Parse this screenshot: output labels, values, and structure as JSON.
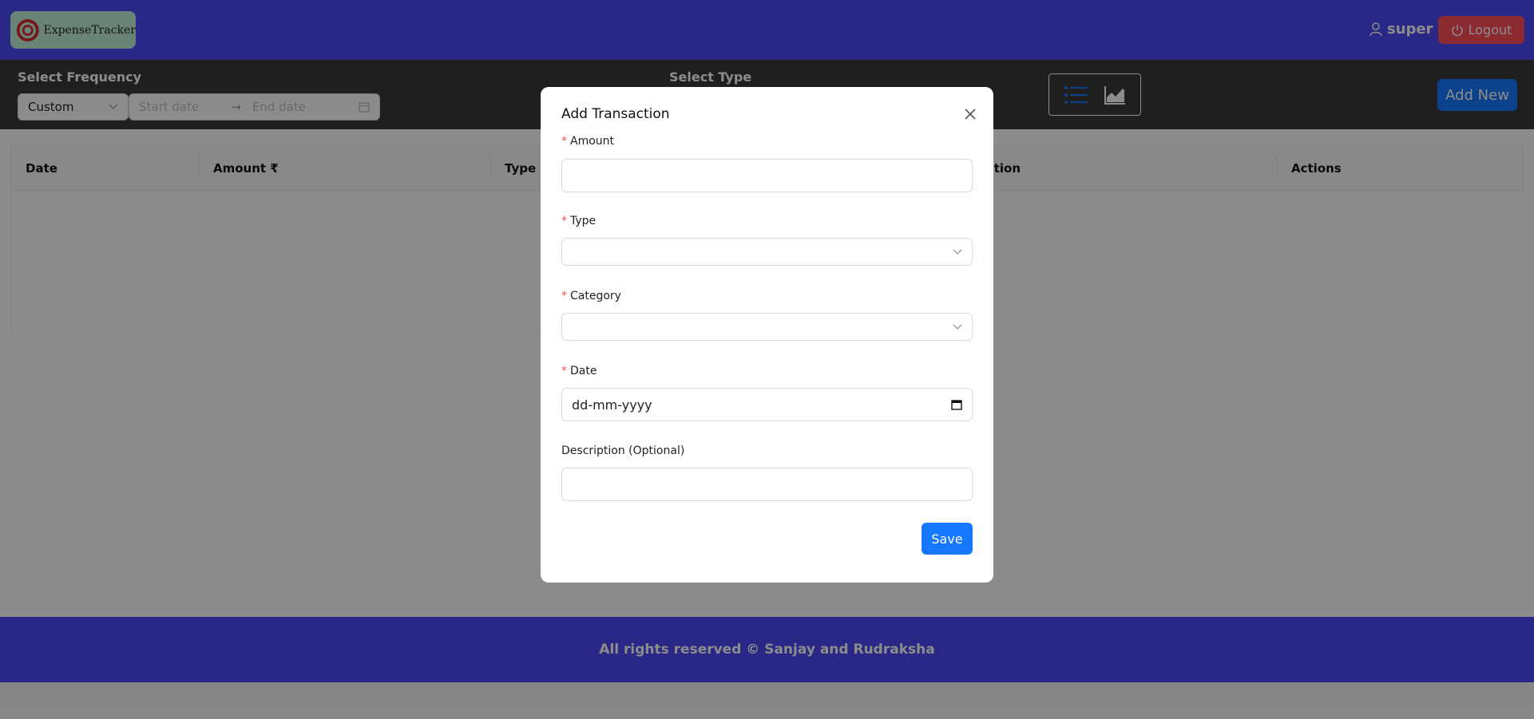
{
  "app": {
    "logo_text": "ExpenseTracker",
    "username": "super",
    "logout_label": "Logout",
    "colors": {
      "header": "#4b4af5",
      "accent": "#1677ff",
      "logout": "#ff4d5a"
    }
  },
  "filters": {
    "frequency_label": "Select Frequency",
    "frequency_value": "Custom",
    "start_placeholder": "Start date",
    "end_placeholder": "End date",
    "type_label": "Select Type",
    "add_new_label": "Add New"
  },
  "table": {
    "columns": [
      "Date",
      "Amount ₹",
      "Type",
      "Description",
      "Actions"
    ]
  },
  "footer": {
    "text": "All rights reserved © Sanjay and Rudraksha"
  },
  "modal": {
    "title": "Add Transaction",
    "amount_label": "Amount",
    "type_label": "Type",
    "category_label": "Category",
    "date_label": "Date",
    "date_placeholder": "dd-mm-yyyy",
    "description_label": "Description (Optional)",
    "save_label": "Save"
  }
}
